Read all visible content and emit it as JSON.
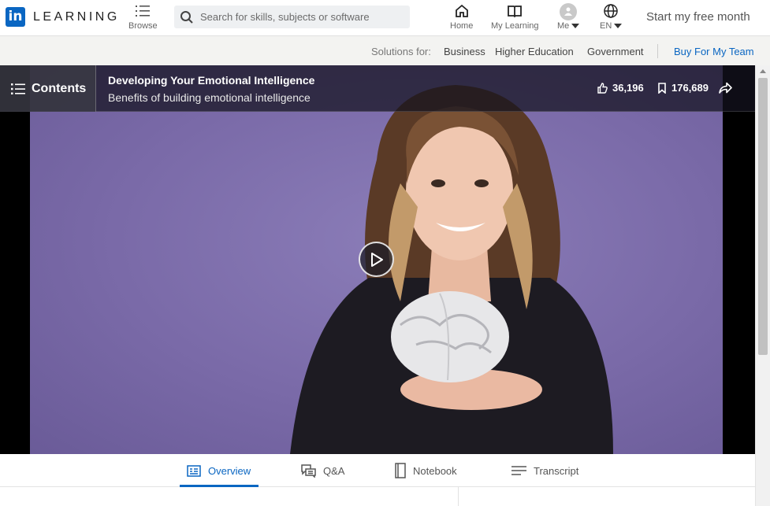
{
  "brand": {
    "logo_text": "in",
    "name": "LEARNING"
  },
  "nav": {
    "browse": "Browse",
    "search_placeholder": "Search for skills, subjects or software",
    "home": "Home",
    "my_learning": "My Learning",
    "me": "Me",
    "language": "EN",
    "cta": "Start my free month"
  },
  "solutions": {
    "label": "Solutions for:",
    "items": [
      "Business",
      "Higher Education",
      "Government"
    ],
    "team": "Buy For My Team"
  },
  "video": {
    "contents_label": "Contents",
    "course_title": "Developing Your Emotional Intelligence",
    "video_title": "Benefits of building emotional intelligence",
    "likes": "36,196",
    "saves": "176,689"
  },
  "tabs": [
    "Overview",
    "Q&A",
    "Notebook",
    "Transcript"
  ],
  "colors": {
    "brand": "#0a66c2",
    "video_bg": "#7a6aa8"
  }
}
